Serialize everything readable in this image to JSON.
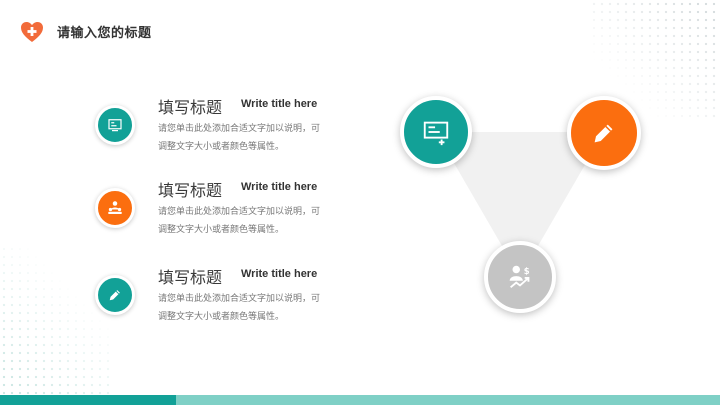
{
  "header": {
    "title": "请输入您的标题",
    "logo_icon": "heart-plus-icon",
    "logo_color": "#f26b3a"
  },
  "items": [
    {
      "title": "填写标题",
      "subtitle": "Write title here",
      "desc_line1": "请您单击此处添加合适文字加以说明，可",
      "desc_line2": "调整文字大小或者颜色等属性。",
      "icon": "presentation-board-icon",
      "color": "#12a197"
    },
    {
      "title": "填写标题",
      "subtitle": "Write title here",
      "desc_line1": "请您单击此处添加合适文字加以说明，可",
      "desc_line2": "调整文字大小或者颜色等属性。",
      "icon": "team-meeting-icon",
      "color": "#fb6e0f"
    },
    {
      "title": "填写标题",
      "subtitle": "Write title here",
      "desc_line1": "请您单击此处添加合适文字加以说明，可",
      "desc_line2": "调整文字大小或者颜色等属性。",
      "icon": "pencil-icon",
      "color": "#12a197"
    }
  ],
  "diagram": {
    "nodes": [
      {
        "icon": "presentation-board-icon",
        "color": "#12a197"
      },
      {
        "icon": "pencil-icon",
        "color": "#fb6e0f"
      },
      {
        "icon": "money-growth-icon",
        "color": "#c4c4c4"
      }
    ],
    "triangle_color": "#f1f1f1"
  },
  "colors": {
    "teal": "#12a197",
    "orange": "#fb6e0f",
    "light_teal": "#7fd0c6",
    "gray": "#c4c4c4"
  }
}
